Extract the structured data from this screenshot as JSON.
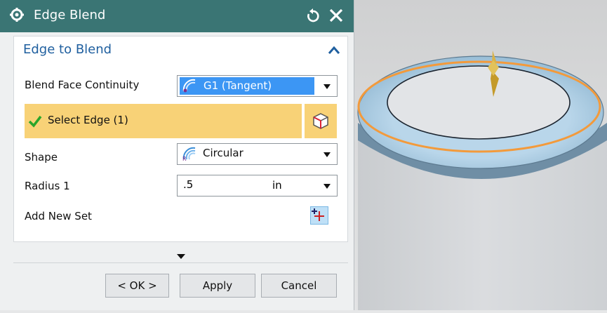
{
  "dialog": {
    "title": "Edge Blend",
    "group_title": "Edge to Blend",
    "blend_face_continuity": {
      "label": "Blend Face Continuity",
      "value": "G1 (Tangent)"
    },
    "select_edge": {
      "label": "Select Edge (1)"
    },
    "shape": {
      "label": "Shape",
      "value": "Circular"
    },
    "radius": {
      "label": "Radius 1",
      "value": ".5",
      "unit": "in"
    },
    "add_new_set": {
      "label": "Add New Set"
    },
    "buttons": {
      "ok": "< OK >",
      "apply": "Apply",
      "cancel": "Cancel"
    }
  },
  "colors": {
    "titlebar": "#3a7574",
    "group_title": "#1f5f9f",
    "selection_highlight": "#f8d277",
    "dropdown_selected": "#3c96f4",
    "edge_highlight": "#f39a3b"
  },
  "icons": [
    "gear-icon",
    "reset-icon",
    "close-icon",
    "collapse-icon",
    "tangent-blend-icon",
    "check-icon",
    "select-cube-icon",
    "circular-shape-icon",
    "add-set-icon",
    "expand-more-icon"
  ]
}
